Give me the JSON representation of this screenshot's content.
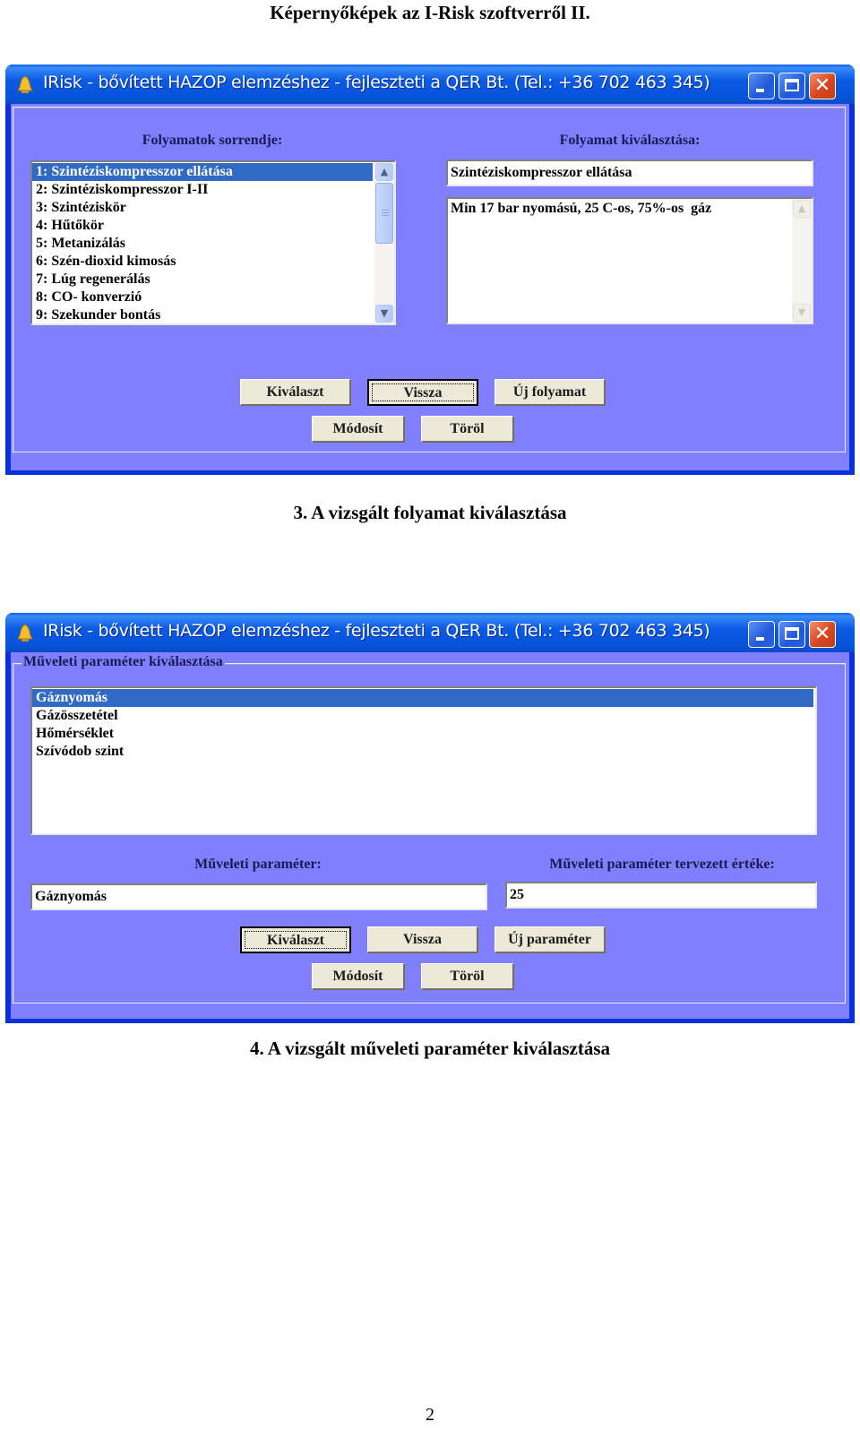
{
  "document": {
    "title": "Képernyőképek az I-Risk szoftverről II.",
    "page_number": "2"
  },
  "window1": {
    "title": "IRisk - bővített HAZOP elemzéshez - fejleszteti a QER Bt. (Tel.: +36 702 463 345)",
    "process_order_label": "Folyamatok sorrendje:",
    "process_list": [
      {
        "label": "1: Szintéziskompresszor ellátása",
        "selected": true
      },
      {
        "label": "2: Szintéziskompresszor I-II",
        "selected": false
      },
      {
        "label": "3: Szintéziskör",
        "selected": false
      },
      {
        "label": "4: Hűtőkör",
        "selected": false
      },
      {
        "label": "5: Metanizálás",
        "selected": false
      },
      {
        "label": "6: Szén-dioxid kimosás",
        "selected": false
      },
      {
        "label": "7: Lúg regenerálás",
        "selected": false
      },
      {
        "label": "8: CO- konverzió",
        "selected": false
      },
      {
        "label": "9: Szekunder bontás",
        "selected": false
      }
    ],
    "process_select_label": "Folyamat kiválasztása:",
    "selected_process_value": "Szintéziskompresszor ellátása",
    "process_description_value": "Min 17 bar nyomású, 25 C-os, 75%-os  gáz",
    "buttons": {
      "select": "Kiválaszt",
      "back": "Vissza",
      "new": "Új folyamat",
      "modify": "Módosít",
      "delete": "Töröl"
    },
    "default_button": "back"
  },
  "caption1": "3. A vizsgált folyamat kiválasztása",
  "window2": {
    "title": "IRisk - bővített HAZOP elemzéshez - fejleszteti a QER Bt. (Tel.: +36 702 463 345)",
    "group_label": "Műveleti paraméter kiválasztása",
    "parameter_list": [
      {
        "label": "Gáznyomás",
        "selected": true
      },
      {
        "label": "Gázösszetétel",
        "selected": false
      },
      {
        "label": "Hőmérséklet",
        "selected": false
      },
      {
        "label": "Szívódob szint",
        "selected": false
      }
    ],
    "parameter_label": "Műveleti paraméter:",
    "parameter_value": "Gáznyomás",
    "design_value_label": "Műveleti paraméter tervezett értéke:",
    "design_value": "25",
    "buttons": {
      "select": "Kiválaszt",
      "back": "Vissza",
      "new": "Új paraméter",
      "modify": "Módosít",
      "delete": "Töröl"
    },
    "default_button": "select"
  },
  "caption2": "4. A vizsgált műveleti paraméter kiválasztása",
  "icons": {
    "app": "bell-icon",
    "minimize": "minimize-icon",
    "maximize": "maximize-icon",
    "close": "close-icon",
    "scroll_up": "chevron-up-icon",
    "scroll_down": "chevron-down-icon"
  },
  "colors": {
    "client_background": "#8080ff",
    "titlebar": "#0a5ae6",
    "selection": "#316ac5",
    "close_button": "#d8461f",
    "button_face": "#ece9d8"
  }
}
